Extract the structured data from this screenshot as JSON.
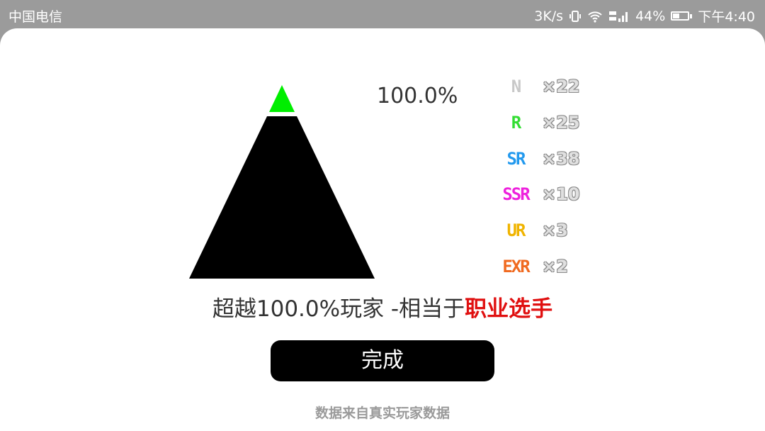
{
  "status_bar": {
    "carrier": "中国电信",
    "speed": "3K/s",
    "network": "4G 2G",
    "battery": "44%",
    "battery_level": 0.44,
    "time": "下午4:40"
  },
  "pyramid": {
    "percent_label": "100.0%",
    "fill_fraction": 1.0,
    "top_color": "#00ee00",
    "base_color": "#000000"
  },
  "ranks": [
    {
      "label": "N",
      "count": "×22",
      "color": "#c8c8c8"
    },
    {
      "label": "R",
      "count": "×25",
      "color": "#33dd33"
    },
    {
      "label": "SR",
      "count": "×38",
      "color": "#2299ee"
    },
    {
      "label": "SSR",
      "count": "×10",
      "color": "#ee22dd"
    },
    {
      "label": "UR",
      "count": "×3",
      "color": "#f0b400"
    },
    {
      "label": "EXR",
      "count": "×2",
      "color": "#f06a20"
    }
  ],
  "result": {
    "text": "超越100.0%玩家 -相当于",
    "title": "职业选手",
    "title_color": "#e01010"
  },
  "done_button": {
    "label": "完成"
  },
  "footer": {
    "note": "数据来自真实玩家数据"
  }
}
